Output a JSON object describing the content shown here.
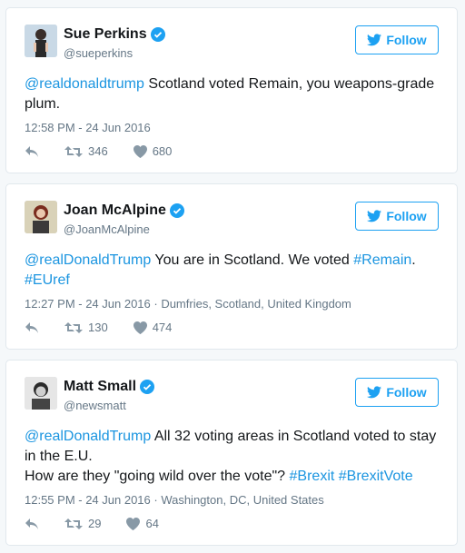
{
  "colors": {
    "accent": "#1da1f2",
    "link": "#1b95e0",
    "muted": "#657786"
  },
  "follow_label": "Follow",
  "tweets": [
    {
      "name": "Sue Perkins",
      "handle": "@sueperkins",
      "text_parts": [
        {
          "t": "@realdonaldtrump",
          "link": true
        },
        {
          "t": " Scotland voted Remain, you weapons-grade plum.",
          "link": false
        }
      ],
      "timestamp": "12:58 PM - 24 Jun 2016",
      "retweets": "346",
      "likes": "680"
    },
    {
      "name": "Joan McAlpine",
      "handle": "@JoanMcAlpine",
      "text_parts": [
        {
          "t": "@realDonaldTrump",
          "link": true
        },
        {
          "t": " You are in Scotland. We voted ",
          "link": false
        },
        {
          "t": "#Remain",
          "link": true
        },
        {
          "t": ". ",
          "link": false
        },
        {
          "t": "#EUref",
          "link": true
        }
      ],
      "timestamp": "12:27 PM - 24 Jun 2016 · Dumfries, Scotland, United Kingdom",
      "retweets": "130",
      "likes": "474"
    },
    {
      "name": "Matt Small",
      "handle": "@newsmatt",
      "text_parts": [
        {
          "t": "@realDonaldTrump",
          "link": true
        },
        {
          "t": " All 32 voting areas in Scotland voted to stay in the E.U.\nHow are they \"going wild over the vote\"? ",
          "link": false
        },
        {
          "t": "#Brexit",
          "link": true
        },
        {
          "t": " ",
          "link": false
        },
        {
          "t": "#BrexitVote",
          "link": true
        }
      ],
      "timestamp": "12:55 PM - 24 Jun 2016 · Washington, DC, United States",
      "retweets": "29",
      "likes": "64"
    }
  ]
}
